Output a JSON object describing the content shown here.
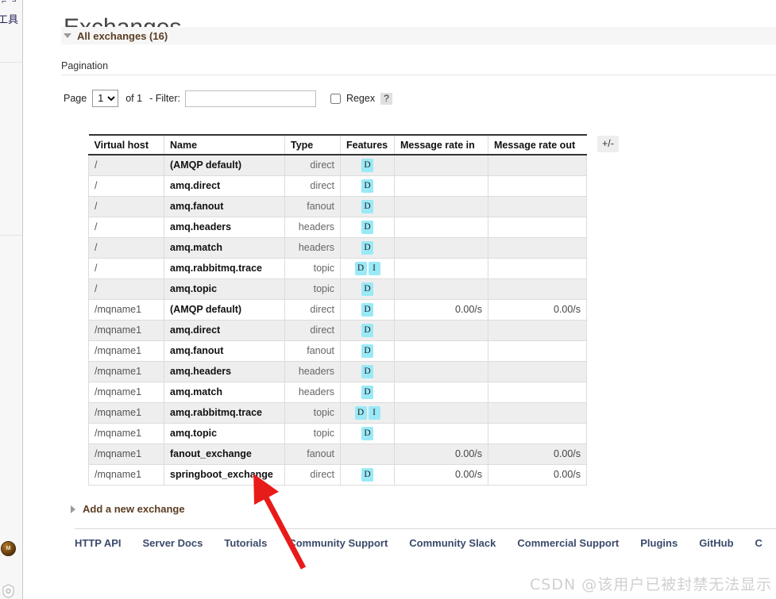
{
  "browser_strip": {
    "tools_label": "工具",
    "avatar_initials": "M"
  },
  "page": {
    "title": "Exchanges",
    "section": {
      "label": "All exchanges (16)",
      "expanded": true
    },
    "pagination": {
      "heading": "Pagination",
      "page_label": "Page",
      "page_value": "1",
      "page_options": [
        "1"
      ],
      "of_label": "of 1",
      "filter_label": "- Filter:",
      "filter_value": "",
      "filter_placeholder": "",
      "regex_label": "Regex",
      "regex_checked": false,
      "help_label": "?"
    },
    "table": {
      "columns": [
        "Virtual host",
        "Name",
        "Type",
        "Features",
        "Message rate in",
        "Message rate out"
      ],
      "toggle_columns_label": "+/-",
      "rows": [
        {
          "vhost": "/",
          "name": "(AMQP default)",
          "type": "direct",
          "features": [
            "D"
          ],
          "rate_in": "",
          "rate_out": ""
        },
        {
          "vhost": "/",
          "name": "amq.direct",
          "type": "direct",
          "features": [
            "D"
          ],
          "rate_in": "",
          "rate_out": ""
        },
        {
          "vhost": "/",
          "name": "amq.fanout",
          "type": "fanout",
          "features": [
            "D"
          ],
          "rate_in": "",
          "rate_out": ""
        },
        {
          "vhost": "/",
          "name": "amq.headers",
          "type": "headers",
          "features": [
            "D"
          ],
          "rate_in": "",
          "rate_out": ""
        },
        {
          "vhost": "/",
          "name": "amq.match",
          "type": "headers",
          "features": [
            "D"
          ],
          "rate_in": "",
          "rate_out": ""
        },
        {
          "vhost": "/",
          "name": "amq.rabbitmq.trace",
          "type": "topic",
          "features": [
            "D",
            "I"
          ],
          "rate_in": "",
          "rate_out": ""
        },
        {
          "vhost": "/",
          "name": "amq.topic",
          "type": "topic",
          "features": [
            "D"
          ],
          "rate_in": "",
          "rate_out": ""
        },
        {
          "vhost": "/mqname1",
          "name": "(AMQP default)",
          "type": "direct",
          "features": [
            "D"
          ],
          "rate_in": "0.00/s",
          "rate_out": "0.00/s"
        },
        {
          "vhost": "/mqname1",
          "name": "amq.direct",
          "type": "direct",
          "features": [
            "D"
          ],
          "rate_in": "",
          "rate_out": ""
        },
        {
          "vhost": "/mqname1",
          "name": "amq.fanout",
          "type": "fanout",
          "features": [
            "D"
          ],
          "rate_in": "",
          "rate_out": ""
        },
        {
          "vhost": "/mqname1",
          "name": "amq.headers",
          "type": "headers",
          "features": [
            "D"
          ],
          "rate_in": "",
          "rate_out": ""
        },
        {
          "vhost": "/mqname1",
          "name": "amq.match",
          "type": "headers",
          "features": [
            "D"
          ],
          "rate_in": "",
          "rate_out": ""
        },
        {
          "vhost": "/mqname1",
          "name": "amq.rabbitmq.trace",
          "type": "topic",
          "features": [
            "D",
            "I"
          ],
          "rate_in": "",
          "rate_out": ""
        },
        {
          "vhost": "/mqname1",
          "name": "amq.topic",
          "type": "topic",
          "features": [
            "D"
          ],
          "rate_in": "",
          "rate_out": ""
        },
        {
          "vhost": "/mqname1",
          "name": "fanout_exchange",
          "type": "fanout",
          "features": [],
          "rate_in": "0.00/s",
          "rate_out": "0.00/s"
        },
        {
          "vhost": "/mqname1",
          "name": "springboot_exchange",
          "type": "direct",
          "features": [
            "D"
          ],
          "rate_in": "0.00/s",
          "rate_out": "0.00/s"
        }
      ]
    },
    "add_exchange": {
      "label": "Add a new exchange",
      "expanded": false
    },
    "footer": {
      "links": [
        "HTTP API",
        "Server Docs",
        "Tutorials",
        "Community Support",
        "Community Slack",
        "Commercial Support",
        "Plugins",
        "GitHub",
        "C"
      ]
    },
    "watermark": "CSDN @该用户已被封禁无法显示",
    "annotation": {
      "type": "arrow",
      "color": "#e81b1b"
    }
  }
}
